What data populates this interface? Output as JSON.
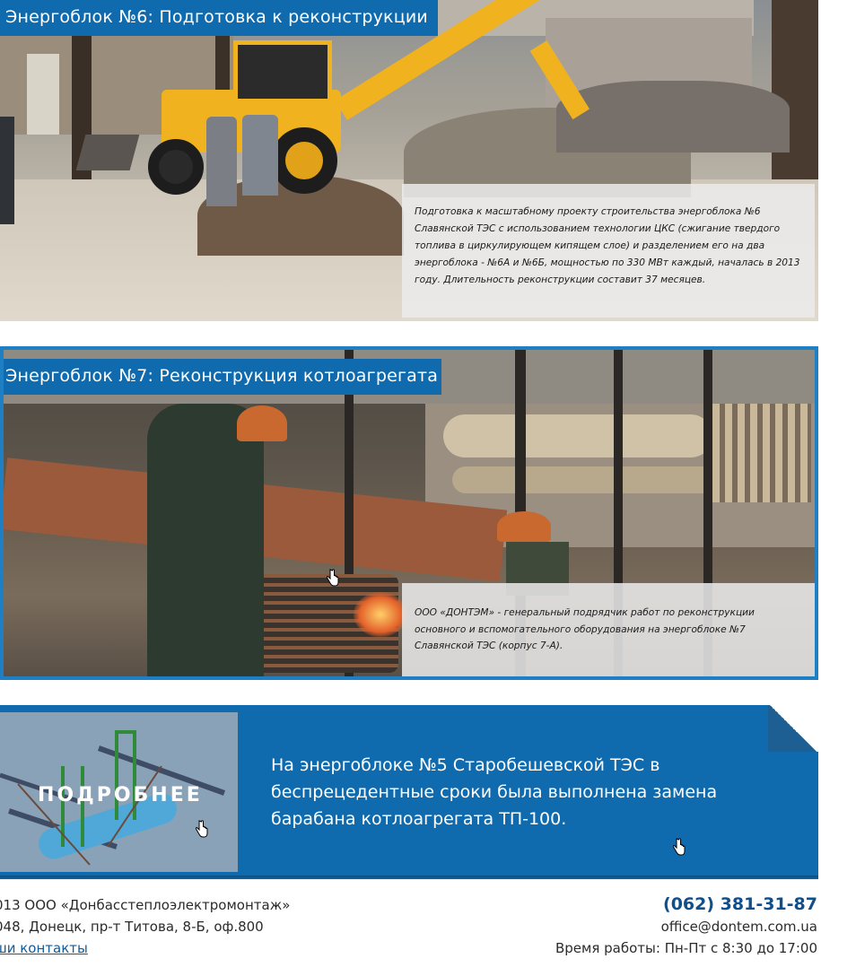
{
  "panel6": {
    "title": "Энергоблок №6: Подготовка к реконструкции",
    "caption": "Подготовка к масштабному проекту строительства энергоблока №6 Славянской ТЭС с использованием технологии ЦКС (сжигание твердого топлива в циркулирующем кипящем слое) и разделением его на два энергоблока - №6А и №6Б, мощностью по 330 МВт каждый, началась в 2013 году. Длительность реконструкции составит 37 месяцев."
  },
  "panel7": {
    "title": "Энергоблок №7: Реконструкция котлоагрегата",
    "caption": "ООО «ДОНТЭМ» - генеральный подрядчик работ по реконструкции основного и вспомогательного оборудования на энергоблоке №7 Славянской ТЭС (корпус 7-А)."
  },
  "promo": {
    "more_label": "ПОДРОБНЕЕ",
    "text": "На энергоблоке №5 Старобешевской ТЭС в беспрецедентные сроки была выполнена замена барабана котлоагрегата ТП-100."
  },
  "footer": {
    "copyright": "013 ООО «Донбасстеплоэлектромонтаж»",
    "address": "048, Донецк, пр-т Титова, 8-Б, оф.800",
    "contacts_link": "ши контакты",
    "phone": "(062) 381-31-87",
    "email": "office@dontem.com.ua",
    "hours": "Время работы: Пн-Пт с 8:30 до 17:00"
  },
  "colors": {
    "brand_blue": "#0f6aae",
    "panel_border": "#1f7fc4",
    "phone": "#0f4f8c"
  },
  "icons": [
    "hand-cursor-icon"
  ]
}
